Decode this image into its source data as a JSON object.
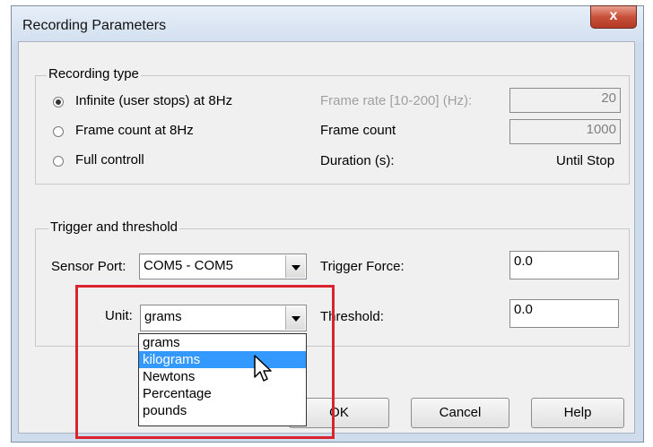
{
  "window": {
    "title": "Recording Parameters",
    "close_glyph": "x"
  },
  "recording_type": {
    "legend": "Recording type",
    "options": [
      {
        "label": "Infinite (user stops) at 8Hz",
        "checked": true
      },
      {
        "label": "Frame count at 8Hz",
        "checked": false
      },
      {
        "label": "Full controll",
        "checked": false
      }
    ],
    "frame_rate_label": "Frame rate [10-200] (Hz):",
    "frame_rate_value": "20",
    "frame_count_label": "Frame count",
    "frame_count_value": "1000",
    "duration_label": "Duration (s):",
    "duration_value": "Until Stop"
  },
  "trigger": {
    "legend": "Trigger and threshold",
    "sensor_port_label": "Sensor Port:",
    "sensor_port_value": "COM5 - COM5",
    "trigger_force_label": "Trigger Force:",
    "trigger_force_value": "0.0",
    "unit_label": "Unit:",
    "unit_value": "grams",
    "threshold_label": "Threshold:",
    "threshold_value": "0.0"
  },
  "unit_dropdown": {
    "options": [
      "grams",
      "kilograms",
      "Newtons",
      "Percentage",
      "pounds"
    ],
    "highlighted": "kilograms"
  },
  "buttons": {
    "ok": "OK",
    "cancel": "Cancel",
    "help": "Help"
  },
  "colors": {
    "highlight_box": "#d9232e",
    "selection": "#3399ff",
    "close_button": "#c8503a"
  }
}
